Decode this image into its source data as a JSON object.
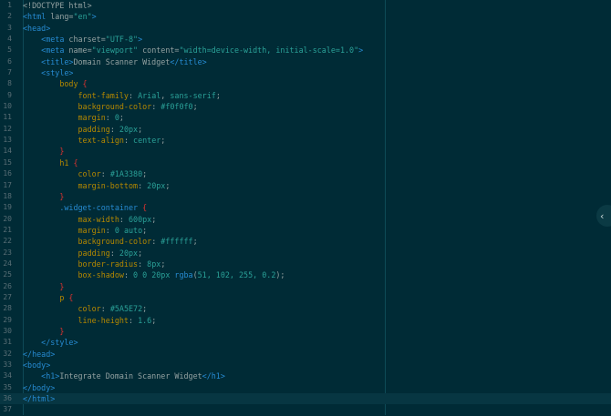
{
  "editor": {
    "language": "html",
    "active_line": 36,
    "collapse_icon": "chevron-left-icon",
    "lines": [
      {
        "n": "1",
        "t": [
          [
            "doctype",
            "<!DOCTYPE html>"
          ]
        ]
      },
      {
        "n": "2",
        "t": [
          [
            "tag",
            "<html"
          ],
          [
            "attr",
            " lang="
          ],
          [
            "str",
            "\"en\""
          ],
          [
            "tag",
            ">"
          ]
        ]
      },
      {
        "n": "3",
        "t": [
          [
            "tag",
            "<head>"
          ]
        ]
      },
      {
        "n": "4",
        "t": [
          [
            "text",
            "    "
          ],
          [
            "tag",
            "<meta"
          ],
          [
            "attr",
            " charset="
          ],
          [
            "str",
            "\"UTF-8\""
          ],
          [
            "tag",
            ">"
          ]
        ]
      },
      {
        "n": "5",
        "t": [
          [
            "text",
            "    "
          ],
          [
            "tag",
            "<meta"
          ],
          [
            "attr",
            " name="
          ],
          [
            "str",
            "\"viewport\""
          ],
          [
            "attr",
            " content="
          ],
          [
            "str",
            "\"width=device-width, initial-scale=1.0\""
          ],
          [
            "tag",
            ">"
          ]
        ]
      },
      {
        "n": "6",
        "t": [
          [
            "text",
            "    "
          ],
          [
            "tag",
            "<title>"
          ],
          [
            "text",
            "Domain Scanner Widget"
          ],
          [
            "tag",
            "</title>"
          ]
        ]
      },
      {
        "n": "7",
        "t": [
          [
            "text",
            "    "
          ],
          [
            "tag",
            "<style>"
          ]
        ]
      },
      {
        "n": "8",
        "t": [
          [
            "text",
            "        "
          ],
          [
            "sel",
            "body"
          ],
          [
            "brace",
            " {"
          ]
        ]
      },
      {
        "n": "9",
        "t": [
          [
            "text",
            "            "
          ],
          [
            "prop",
            "font-family"
          ],
          [
            "punct",
            ": "
          ],
          [
            "val",
            "Arial"
          ],
          [
            "punct",
            ", "
          ],
          [
            "val",
            "sans-serif"
          ],
          [
            "punct",
            ";"
          ]
        ]
      },
      {
        "n": "10",
        "t": [
          [
            "text",
            "            "
          ],
          [
            "prop",
            "background-color"
          ],
          [
            "punct",
            ": "
          ],
          [
            "val",
            "#f0f0f0"
          ],
          [
            "punct",
            ";"
          ]
        ]
      },
      {
        "n": "11",
        "t": [
          [
            "text",
            "            "
          ],
          [
            "prop",
            "margin"
          ],
          [
            "punct",
            ": "
          ],
          [
            "val",
            "0"
          ],
          [
            "punct",
            ";"
          ]
        ]
      },
      {
        "n": "12",
        "t": [
          [
            "text",
            "            "
          ],
          [
            "prop",
            "padding"
          ],
          [
            "punct",
            ": "
          ],
          [
            "val",
            "20px"
          ],
          [
            "punct",
            ";"
          ]
        ]
      },
      {
        "n": "13",
        "t": [
          [
            "text",
            "            "
          ],
          [
            "prop",
            "text-align"
          ],
          [
            "punct",
            ": "
          ],
          [
            "val",
            "center"
          ],
          [
            "punct",
            ";"
          ]
        ]
      },
      {
        "n": "14",
        "t": [
          [
            "text",
            "        "
          ],
          [
            "brace",
            "}"
          ]
        ]
      },
      {
        "n": "15",
        "t": [
          [
            "text",
            "        "
          ],
          [
            "sel",
            "h1"
          ],
          [
            "brace",
            " {"
          ]
        ]
      },
      {
        "n": "16",
        "t": [
          [
            "text",
            "            "
          ],
          [
            "prop",
            "color"
          ],
          [
            "punct",
            ": "
          ],
          [
            "val",
            "#1A3380"
          ],
          [
            "punct",
            ";"
          ]
        ]
      },
      {
        "n": "17",
        "t": [
          [
            "text",
            "            "
          ],
          [
            "prop",
            "margin-bottom"
          ],
          [
            "punct",
            ": "
          ],
          [
            "val",
            "20px"
          ],
          [
            "punct",
            ";"
          ]
        ]
      },
      {
        "n": "18",
        "t": [
          [
            "text",
            "        "
          ],
          [
            "brace",
            "}"
          ]
        ]
      },
      {
        "n": "19",
        "t": [
          [
            "text",
            "        "
          ],
          [
            "class",
            ".widget-container"
          ],
          [
            "brace",
            " {"
          ]
        ]
      },
      {
        "n": "20",
        "t": [
          [
            "text",
            "            "
          ],
          [
            "prop",
            "max-width"
          ],
          [
            "punct",
            ": "
          ],
          [
            "val",
            "600px"
          ],
          [
            "punct",
            ";"
          ]
        ]
      },
      {
        "n": "21",
        "t": [
          [
            "text",
            "            "
          ],
          [
            "prop",
            "margin"
          ],
          [
            "punct",
            ": "
          ],
          [
            "val",
            "0 auto"
          ],
          [
            "punct",
            ";"
          ]
        ]
      },
      {
        "n": "22",
        "t": [
          [
            "text",
            "            "
          ],
          [
            "prop",
            "background-color"
          ],
          [
            "punct",
            ": "
          ],
          [
            "val",
            "#ffffff"
          ],
          [
            "punct",
            ";"
          ]
        ]
      },
      {
        "n": "23",
        "t": [
          [
            "text",
            "            "
          ],
          [
            "prop",
            "padding"
          ],
          [
            "punct",
            ": "
          ],
          [
            "val",
            "20px"
          ],
          [
            "punct",
            ";"
          ]
        ]
      },
      {
        "n": "24",
        "t": [
          [
            "text",
            "            "
          ],
          [
            "prop",
            "border-radius"
          ],
          [
            "punct",
            ": "
          ],
          [
            "val",
            "8px"
          ],
          [
            "punct",
            ";"
          ]
        ]
      },
      {
        "n": "25",
        "t": [
          [
            "text",
            "            "
          ],
          [
            "prop",
            "box-shadow"
          ],
          [
            "punct",
            ": "
          ],
          [
            "val",
            "0 0 20px "
          ],
          [
            "fn",
            "rgba"
          ],
          [
            "punct",
            "("
          ],
          [
            "val",
            "51, 102, 255, 0.2"
          ],
          [
            "punct",
            ");"
          ]
        ]
      },
      {
        "n": "26",
        "t": [
          [
            "text",
            "        "
          ],
          [
            "brace",
            "}"
          ]
        ]
      },
      {
        "n": "27",
        "t": [
          [
            "text",
            "        "
          ],
          [
            "sel",
            "p"
          ],
          [
            "brace",
            " {"
          ]
        ]
      },
      {
        "n": "28",
        "t": [
          [
            "text",
            "            "
          ],
          [
            "prop",
            "color"
          ],
          [
            "punct",
            ": "
          ],
          [
            "val",
            "#5A5E72"
          ],
          [
            "punct",
            ";"
          ]
        ]
      },
      {
        "n": "29",
        "t": [
          [
            "text",
            "            "
          ],
          [
            "prop",
            "line-height"
          ],
          [
            "punct",
            ": "
          ],
          [
            "val",
            "1.6"
          ],
          [
            "punct",
            ";"
          ]
        ]
      },
      {
        "n": "30",
        "t": [
          [
            "text",
            "        "
          ],
          [
            "brace",
            "}"
          ]
        ]
      },
      {
        "n": "31",
        "t": [
          [
            "text",
            "    "
          ],
          [
            "tag",
            "</style>"
          ]
        ]
      },
      {
        "n": "32",
        "t": [
          [
            "tag",
            "</head>"
          ]
        ]
      },
      {
        "n": "33",
        "t": [
          [
            "tag",
            "<body>"
          ]
        ]
      },
      {
        "n": "34",
        "t": [
          [
            "text",
            "    "
          ],
          [
            "tag",
            "<h1>"
          ],
          [
            "text",
            "Integrate Domain Scanner Widget"
          ],
          [
            "tag",
            "</h1>"
          ]
        ]
      },
      {
        "n": "35",
        "t": [
          [
            "tag",
            "</body>"
          ]
        ]
      },
      {
        "n": "36",
        "t": [
          [
            "tag",
            "</html>"
          ]
        ]
      },
      {
        "n": "37",
        "t": []
      }
    ]
  },
  "colors": {
    "background": "#002b36",
    "active_line": "#073642",
    "tag": "#268bd2",
    "string": "#2aa198",
    "property": "#b58900",
    "brace": "#dc322f",
    "line_number": "#586e75"
  }
}
